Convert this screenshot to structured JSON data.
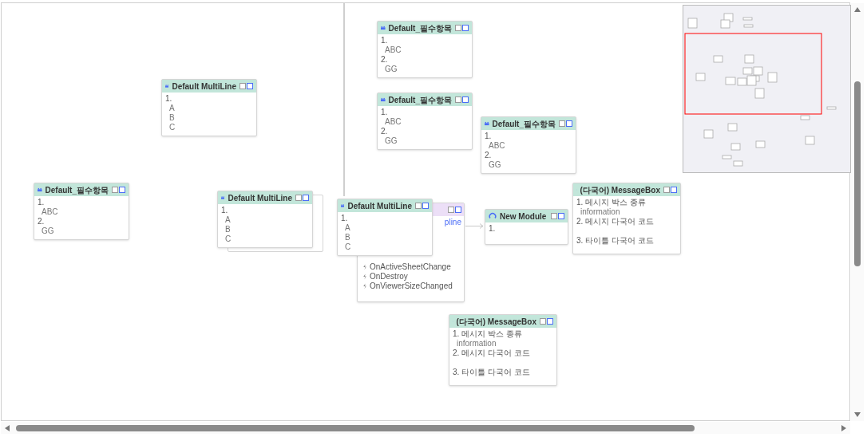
{
  "nodes": [
    {
      "kind": "module",
      "title": "Default MultiLine",
      "lines": [
        {
          "kind": "number",
          "text": "1."
        },
        {
          "kind": "value",
          "text": "A"
        },
        {
          "kind": "value",
          "text": "B"
        },
        {
          "kind": "value",
          "text": "C"
        }
      ]
    },
    {
      "kind": "module",
      "title": "Default_필수항목",
      "lines": [
        {
          "kind": "number",
          "text": "1."
        },
        {
          "kind": "value",
          "text": "ABC"
        },
        {
          "kind": "number",
          "text": "2."
        },
        {
          "kind": "value",
          "text": "GG"
        }
      ]
    },
    {
      "kind": "module",
      "title": "Default MultiLine",
      "lines": [
        {
          "kind": "number",
          "text": "1."
        },
        {
          "kind": "value",
          "text": "A"
        },
        {
          "kind": "value",
          "text": "B"
        },
        {
          "kind": "value",
          "text": "C"
        }
      ]
    },
    {
      "kind": "module",
      "title": "Default_필수항목",
      "lines": [
        {
          "kind": "number",
          "text": "1."
        },
        {
          "kind": "value",
          "text": "ABC"
        },
        {
          "kind": "number",
          "text": "2."
        },
        {
          "kind": "value",
          "text": "GG"
        }
      ]
    },
    {
      "kind": "module",
      "title": "Default_필수항목",
      "lines": [
        {
          "kind": "number",
          "text": "1."
        },
        {
          "kind": "value",
          "text": "ABC"
        },
        {
          "kind": "number",
          "text": "2."
        },
        {
          "kind": "value",
          "text": "GG"
        }
      ]
    },
    {
      "kind": "module",
      "title": "Default_필수항목",
      "lines": [
        {
          "kind": "number",
          "text": "1."
        },
        {
          "kind": "value",
          "text": "ABC"
        },
        {
          "kind": "number",
          "text": "2."
        },
        {
          "kind": "value",
          "text": "GG"
        }
      ]
    },
    {
      "kind": "event",
      "link": "pline",
      "lines": [
        {
          "kind": "event",
          "text": "OnActiveSheetChange"
        },
        {
          "kind": "event",
          "text": "OnDestroy"
        },
        {
          "kind": "event",
          "text": "OnViewerSizeChanged"
        }
      ]
    },
    {
      "kind": "module",
      "title": "Default MultiLine",
      "lines": [
        {
          "kind": "number",
          "text": "1."
        },
        {
          "kind": "value",
          "text": "A"
        },
        {
          "kind": "value",
          "text": "B"
        },
        {
          "kind": "value",
          "text": "C"
        }
      ]
    },
    {
      "kind": "new",
      "title": "New Module",
      "lines": [
        {
          "kind": "number",
          "text": "1."
        }
      ]
    },
    {
      "kind": "module",
      "title": "(다국어) MessageBox",
      "lines": [
        {
          "kind": "number",
          "text": "1. 메시지 박스 종류"
        },
        {
          "kind": "value",
          "text": "information"
        },
        {
          "kind": "number",
          "text": "2. 메시지 다국어 코드"
        },
        {
          "kind": "spaced",
          "text": "3. 타이틀 다국어 코드"
        }
      ]
    },
    {
      "kind": "module",
      "title": "(다국어) MessageBox",
      "lines": [
        {
          "kind": "number",
          "text": "1. 메시지 박스 종류"
        },
        {
          "kind": "value",
          "text": "information"
        },
        {
          "kind": "number",
          "text": "2. 메시지 다국어 코드"
        },
        {
          "kind": "spaced",
          "text": "3. 타이틀 다국어 코드"
        }
      ]
    }
  ]
}
